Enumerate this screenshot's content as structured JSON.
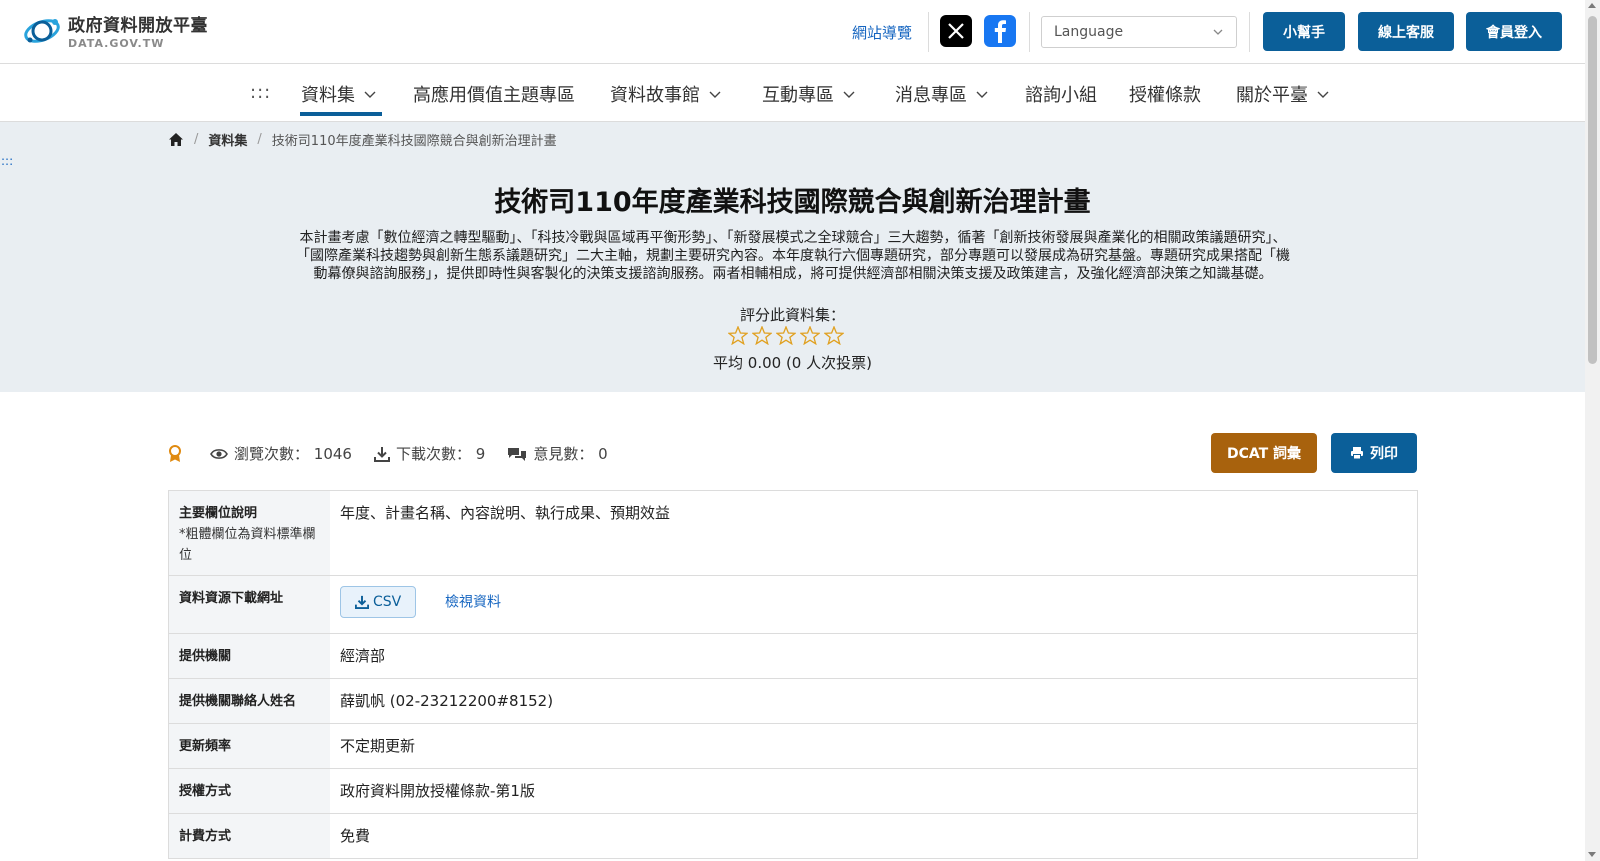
{
  "header": {
    "logo_title": "政府資料開放平臺",
    "logo_sub": "DATA.GOV.TW",
    "sitemap": "網站導覽",
    "social_x": "x-icon",
    "social_fb": "facebook-icon",
    "language_placeholder": "Language",
    "btn_helper": "小幫手",
    "btn_service": "線上客服",
    "btn_login": "會員登入"
  },
  "nav": {
    "dots": ":::",
    "items": [
      {
        "label": "資料集"
      },
      {
        "label": "高應用價值主題專區"
      },
      {
        "label": "資料故事館"
      },
      {
        "label": "互動專區"
      },
      {
        "label": "消息專區"
      },
      {
        "label": "諮詢小組"
      },
      {
        "label": "授權條款"
      },
      {
        "label": "關於平臺"
      }
    ]
  },
  "breadcrumb": {
    "home_icon": "home-icon",
    "level1": "資料集",
    "current": "技術司110年度產業科技國際競合與創新治理計畫"
  },
  "side_dots": ":::",
  "dataset": {
    "title": "技術司110年度產業科技國際競合與創新治理計畫",
    "desc_line1": "本計畫考慮「數位經濟之轉型驅動」、「科技冷戰與區域再平衡形勢」、「新發展模式之全球競合」三大趨勢，循著「創新技術發展與產業化的相關政策議題研究」、",
    "desc_line2": "「國際產業科技趨勢與創新生態系議題研究」二大主軸，規劃主要研究內容。本年度執行六個專題研究，部分專題可以發展成為研究基盤。專題研究成果搭配「機",
    "desc_line3": "動幕僚與諮詢服務」，提供即時性與客製化的決策支援諮詢服務。兩者相輔相成，將可提供經濟部相關決策支援及政策建言，及強化經濟部決策之知識基礎。",
    "rate_label": "評分此資料集：",
    "star_count": 5,
    "rating_value": 0,
    "avg_text": "平均 0.00 (0 人次投票)"
  },
  "stats": {
    "badge_icon": "medal-icon",
    "views_label": "瀏覽次數：",
    "views": "1046",
    "downloads_label": "下載次數：",
    "downloads": "9",
    "comments_label": "意見數：",
    "comments": "0",
    "btn_dcat": "DCAT 詞彙",
    "btn_print": "列印"
  },
  "table": {
    "fields_label": "主要欄位說明",
    "fields_note": "*粗體欄位為資料標準欄位",
    "fields_value": "年度、計畫名稱、內容說明、執行成果、預期效益",
    "download_label": "資料資源下載網址",
    "csv_label": "CSV",
    "view_data": "檢視資料",
    "agency_label": "提供機關",
    "agency_value": "經濟部",
    "contact_label": "提供機關聯絡人姓名",
    "contact_value": "薛凱帆 (02-23212200#8152)",
    "freq_label": "更新頻率",
    "freq_value": "不定期更新",
    "license_label": "授權方式",
    "license_value": "政府資料開放授權條款-第1版",
    "fee_label": "計費方式",
    "fee_value": "免費"
  }
}
